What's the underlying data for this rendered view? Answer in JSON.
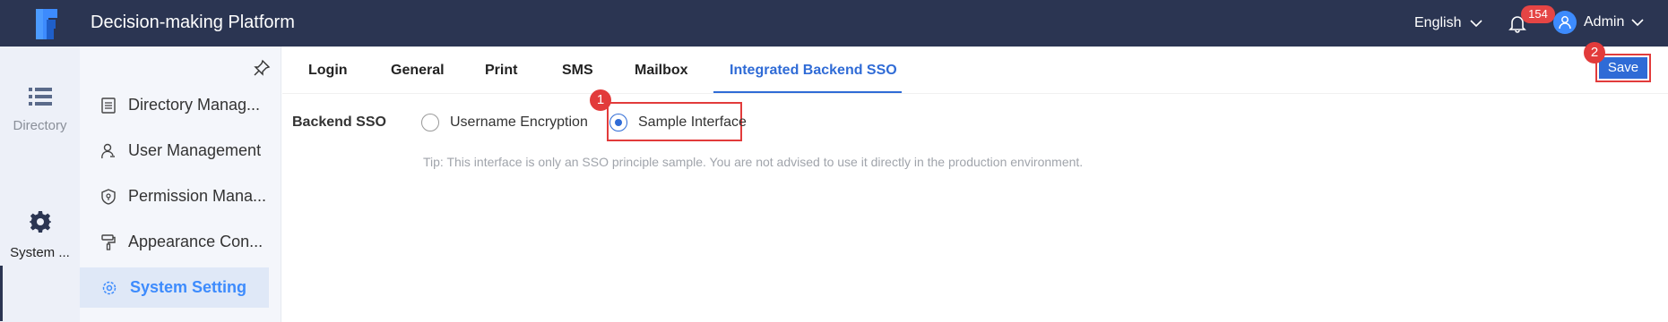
{
  "header": {
    "app_title": "Decision-making Platform",
    "language": "English",
    "notification_count": "154",
    "user_name": "Admin"
  },
  "rail": {
    "items": [
      {
        "label": "Directory",
        "icon": "list-icon"
      },
      {
        "label": "System ...",
        "icon": "gear-icon"
      }
    ]
  },
  "menu": {
    "items": [
      {
        "label": "Directory Manag...",
        "icon": "document-list-icon"
      },
      {
        "label": "User Management",
        "icon": "user-icon"
      },
      {
        "label": "Permission Mana...",
        "icon": "shield-icon"
      },
      {
        "label": "Appearance Con...",
        "icon": "paint-roller-icon"
      },
      {
        "label": "System Setting",
        "icon": "gear-icon"
      }
    ]
  },
  "tabs": [
    "Login",
    "General",
    "Print",
    "SMS",
    "Mailbox",
    "Integrated Backend SSO"
  ],
  "toolbar": {
    "save_label": "Save"
  },
  "form": {
    "field_label": "Backend SSO",
    "options": [
      "Username Encryption",
      "Sample Interface"
    ],
    "selected": "Sample Interface",
    "tip": "Tip: This interface is only an SSO principle sample. You are not advised to use it directly in the production environment."
  },
  "annotations": {
    "step1": "1",
    "step2": "2"
  },
  "colors": {
    "header": "#2b3552",
    "accent": "#2f6bd6",
    "highlight": "#e23b3b"
  }
}
